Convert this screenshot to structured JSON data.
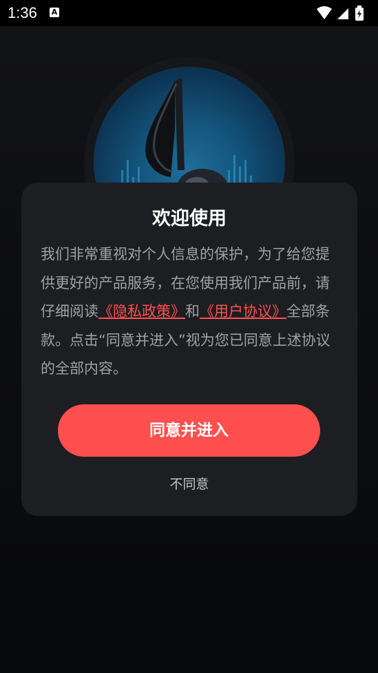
{
  "status_bar": {
    "time": "1:36",
    "accessibility_badge": "A",
    "icons": [
      "wifi-icon",
      "signal-icon",
      "battery-charging-icon"
    ]
  },
  "logo": {
    "icon": "music-note-icon"
  },
  "dialog": {
    "title": "欢迎使用",
    "body_text_1": "我们非常重视对个人信息的保护，为了给您提供更好的产品服务，在您使用我们产品前，请仔细阅读",
    "privacy_link": "《隐私政策》",
    "and_text": "和",
    "agreement_link": "《用户协议》",
    "body_text_2": "全部条款。点击“同意并进入”视为您已同意上述协议的全部内容。",
    "agree_button": "同意并进入",
    "disagree_button": "不同意"
  },
  "colors": {
    "accent": "#ff4f4f",
    "dialog_bg": "#1d1e22",
    "page_bg": "#0b0c0e"
  }
}
